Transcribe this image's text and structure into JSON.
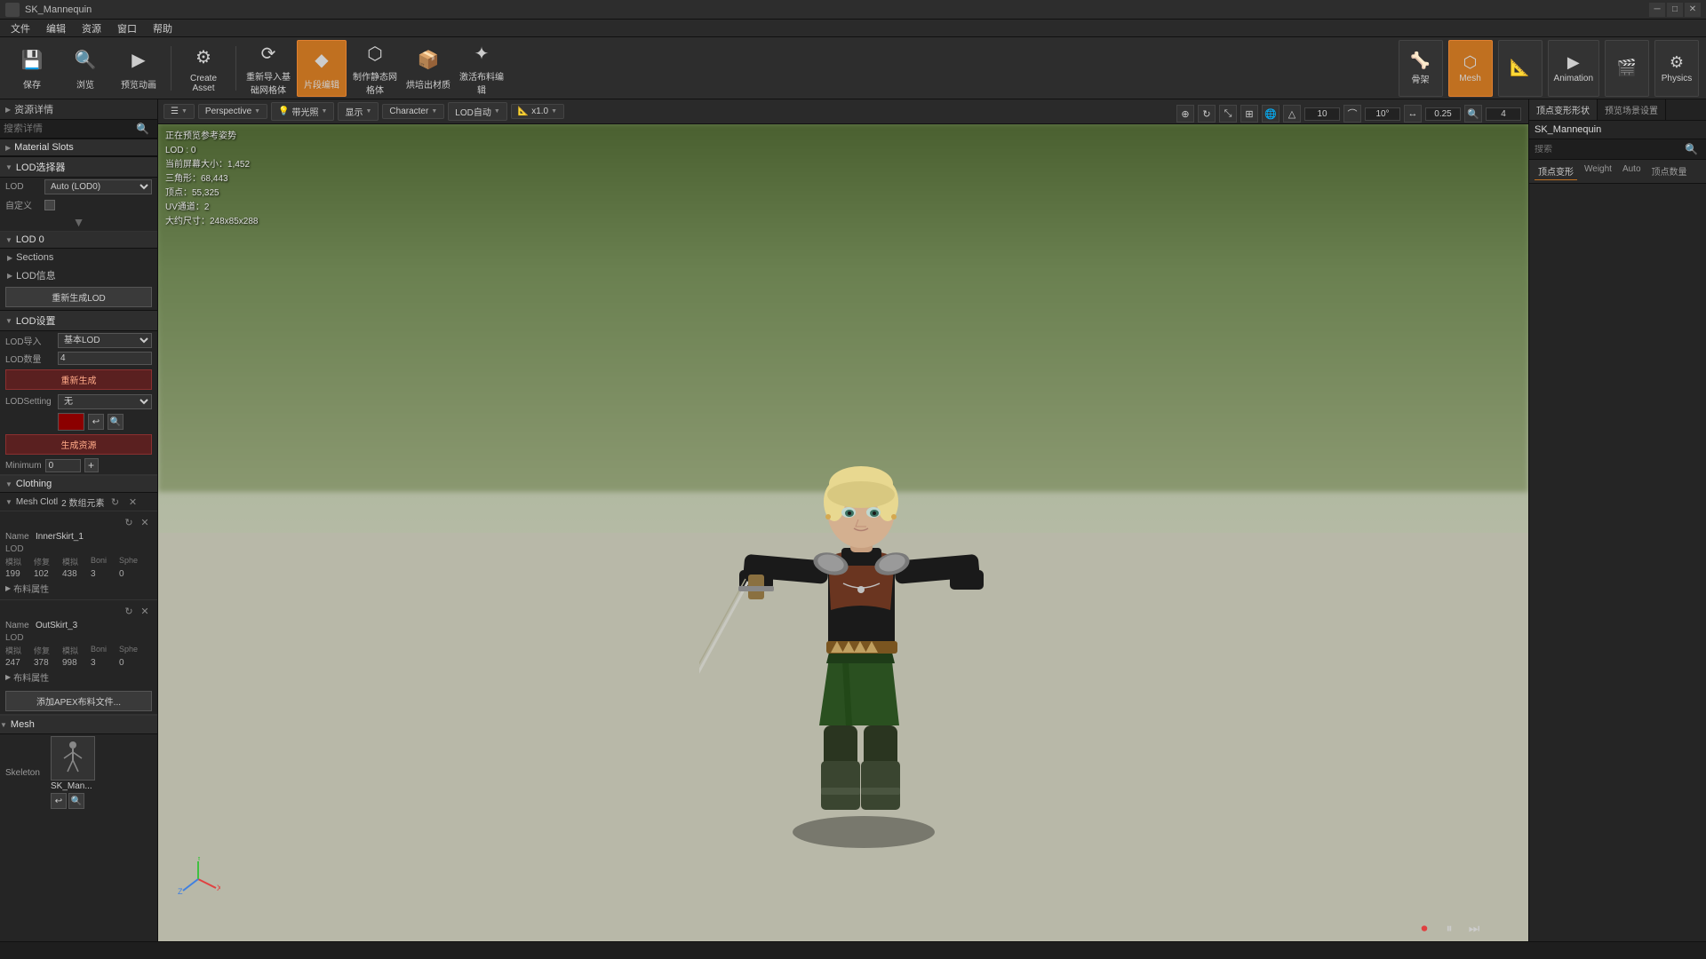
{
  "titleBar": {
    "icon": "UE",
    "title": "SK_Mannequin",
    "buttons": [
      "─",
      "□",
      "✕"
    ]
  },
  "menuBar": {
    "items": [
      "文件",
      "编辑",
      "资源",
      "窗口",
      "帮助"
    ]
  },
  "toolbar": {
    "buttons": [
      {
        "id": "save",
        "icon": "💾",
        "label": "保存"
      },
      {
        "id": "browse",
        "icon": "🔍",
        "label": "浏览"
      },
      {
        "id": "preview",
        "icon": "▶",
        "label": "预览动画"
      },
      {
        "id": "create-asset",
        "icon": "🔧",
        "label": "Create Asset"
      },
      {
        "id": "reimport",
        "icon": "⟳",
        "label": "重新导入基础网格体"
      },
      {
        "id": "active",
        "icon": "◆",
        "label": "片段编辑",
        "active": true
      },
      {
        "id": "static-mesh",
        "icon": "⬡",
        "label": "制作静态网格体"
      },
      {
        "id": "bake",
        "icon": "📦",
        "label": "烘培出材质"
      },
      {
        "id": "activate",
        "icon": "✦",
        "label": "激活布料编辑"
      }
    ],
    "rightButtons": [
      {
        "id": "skeleton",
        "icon": "🦴",
        "label": "骨架"
      },
      {
        "id": "mesh",
        "icon": "⬡",
        "label": "Mesh",
        "active": true
      },
      {
        "id": "anim-blueprint",
        "icon": "📐",
        "label": ""
      },
      {
        "id": "animation",
        "icon": "▶",
        "label": "Animation"
      },
      {
        "id": "anim-montage",
        "icon": "🎬",
        "label": ""
      },
      {
        "id": "physics",
        "icon": "⚙",
        "label": "Physics"
      }
    ]
  },
  "leftPanel": {
    "assetDetails": "资源详情",
    "searchPlaceholder": "搜索详情",
    "sections": {
      "materialSlots": "Material Slots",
      "lodSelector": {
        "title": "LOD选择器",
        "lodLabel": "LOD",
        "lodValue": "Auto (LOD0)",
        "customLabel": "自定义"
      },
      "lod0": {
        "title": "LOD 0",
        "sections": "Sections",
        "lodInfo": "LOD信息",
        "regenerate": "重新生成LOD"
      },
      "lodSettings": {
        "title": "LOD设置",
        "importLabel": "LOD导入",
        "importValue": "基本LOD",
        "countLabel": "LOD数量",
        "countValue": "4",
        "regenerate": "重新生成",
        "settingLabel": "LODSetting",
        "noneLabel": "无",
        "colorSwatch": "#8b0000",
        "generateBtn": "生成资源",
        "minimumLabel": "Minimum",
        "minimumValue": "0"
      },
      "clothing": {
        "title": "Clothing",
        "meshClothTitle": "Mesh Clotl",
        "meshClothCount": "2 数组元素",
        "items": [
          {
            "name": "InnerSkirt_1",
            "lod": "LOD",
            "headers": [
              "模拟",
              "修复",
              "模拟",
              "Boni",
              "Sphe"
            ],
            "values": [
              "199",
              "102",
              "438",
              "3",
              "0"
            ],
            "property": "布料属性"
          },
          {
            "name": "OutSkirt_3",
            "lod": "LOD",
            "headers": [
              "模拟",
              "修复",
              "模拟",
              "Boni",
              "Sphe"
            ],
            "values": [
              "247",
              "378",
              "998",
              "3",
              "0"
            ],
            "property": "布料属性"
          }
        ],
        "addApex": "添加APEX布料文件..."
      },
      "mesh": {
        "title": "Mesh",
        "skeletonLabel": "Skeleton",
        "skeletonName": "SK_Man..."
      }
    }
  },
  "viewport": {
    "perspectiveLabel": "Perspective",
    "lightingLabel": "带光照",
    "showLabel": "显示",
    "characterLabel": "Character",
    "lodLabel": "LOD自动",
    "scaleLabel": "x1.0",
    "info": {
      "line1": "正在预览参考姿势",
      "line2": "LOD : 0",
      "line3": "当前屏幕大小：1,452",
      "line4": "三角形：68,443",
      "line5": "顶点：55,325",
      "line6": "UV通道：2",
      "line7": "大约尺寸：248x85x288"
    },
    "gridValue": "10",
    "rotateValue": "10°",
    "moveValue": "0.25",
    "zoomValue": "4"
  },
  "rightPanel": {
    "tabs1": [
      "顶点变形形状",
      "预览场景设置"
    ],
    "assetName": "SK_Mannequin",
    "searchPlaceholder": "搜索",
    "tabs2": [
      "顶点变形",
      "Weight",
      "Auto",
      "顶点数量"
    ]
  }
}
